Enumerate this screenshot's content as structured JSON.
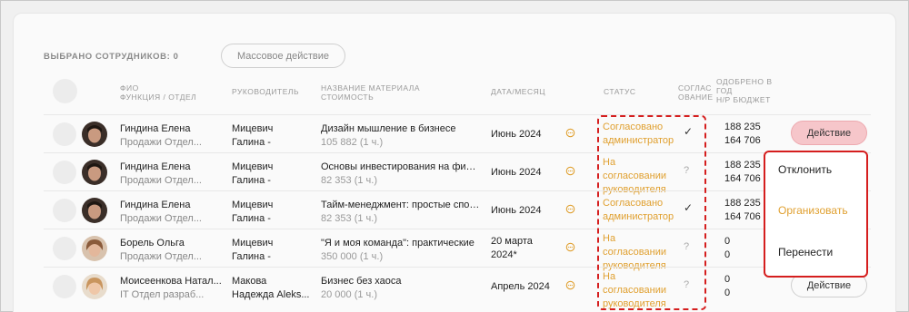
{
  "toolbar": {
    "selected_label": "ВЫБРАНО СОТРУДНИКОВ: 0",
    "mass_action": "Массовое действие"
  },
  "headers": {
    "fio_1": "ФИО",
    "fio_2": "ФУНКЦИЯ / ОТДЕЛ",
    "manager": "РУКОВОДИТЕЛЬ",
    "material_1": "НАЗВАНИЕ МАТЕРИАЛА",
    "material_2": "СТОИМОСТЬ",
    "date": "ДАТА/МЕСЯЦ",
    "status": "СТАТУС",
    "approval_1": "СОГЛАС",
    "approval_2": "ОВАНИЕ",
    "approved_1": "ОДОБРЕНО В",
    "approved_2": "ГОД",
    "approved_3": "Н/Р БЮДЖЕТ"
  },
  "rows": [
    {
      "name": "Гиндина Елена",
      "dept": "Продажи Отдел...",
      "mgr1": "Мицевич",
      "mgr2": "Галина -",
      "title": "Дизайн мышление в бизнесе",
      "cost": "105 882 (1 ч.)",
      "date1": "Июнь 2024",
      "date2": "",
      "status1": "Согласовано",
      "status2": "администратор",
      "status3": "",
      "mark": "✓",
      "bud1": "188 235",
      "bud2": "164 706",
      "action": "Действие"
    },
    {
      "name": "Гиндина Елена",
      "dept": "Продажи Отдел...",
      "mgr1": "Мицевич",
      "mgr2": "Галина -",
      "title": "Основы инвестирования на финансовом рынке",
      "cost": "82 353 (1 ч.)",
      "date1": "Июнь 2024",
      "date2": "",
      "status1": "На",
      "status2": "согласовании",
      "status3": "руководителя",
      "mark": "?",
      "bud1": "188 235",
      "bud2": "164 706",
      "action": ""
    },
    {
      "name": "Гиндина Елена",
      "dept": "Продажи Отдел...",
      "mgr1": "Мицевич",
      "mgr2": "Галина -",
      "title": "Тайм-менеджмент: простые способы",
      "cost": "82 353 (1 ч.)",
      "date1": "Июнь 2024",
      "date2": "",
      "status1": "Согласовано",
      "status2": "администратор",
      "status3": "",
      "mark": "✓",
      "bud1": "188 235",
      "bud2": "164 706",
      "action": ""
    },
    {
      "name": "Борель Ольга",
      "dept": "Продажи Отдел...",
      "mgr1": "Мицевич",
      "mgr2": "Галина -",
      "title": "\"Я и моя команда\": практические",
      "cost": "350 000 (1 ч.)",
      "date1": "20 марта",
      "date2": "2024*",
      "status1": "На",
      "status2": "согласовании",
      "status3": "руководителя",
      "mark": "?",
      "bud1": "0",
      "bud2": "0",
      "action": ""
    },
    {
      "name": "Моисеенкова Натал...",
      "dept": "IT Отдел разраб...",
      "mgr1": "Макова",
      "mgr2": "Надежда Aleks...",
      "title": "Бизнес без хаоса",
      "cost": "20 000 (1 ч.)",
      "date1": "Апрель 2024",
      "date2": "",
      "status1": "На",
      "status2": "согласовании",
      "status3": "руководителя",
      "mark": "?",
      "bud1": "0",
      "bud2": "0",
      "action": "Действие"
    }
  ],
  "menu": {
    "reject": "Отклонить",
    "organize": "Организовать",
    "move": "Перенести"
  },
  "colors": {
    "status": "#e0a030",
    "highlight": "#d51e1e",
    "action_active": "#f6c6ca"
  }
}
